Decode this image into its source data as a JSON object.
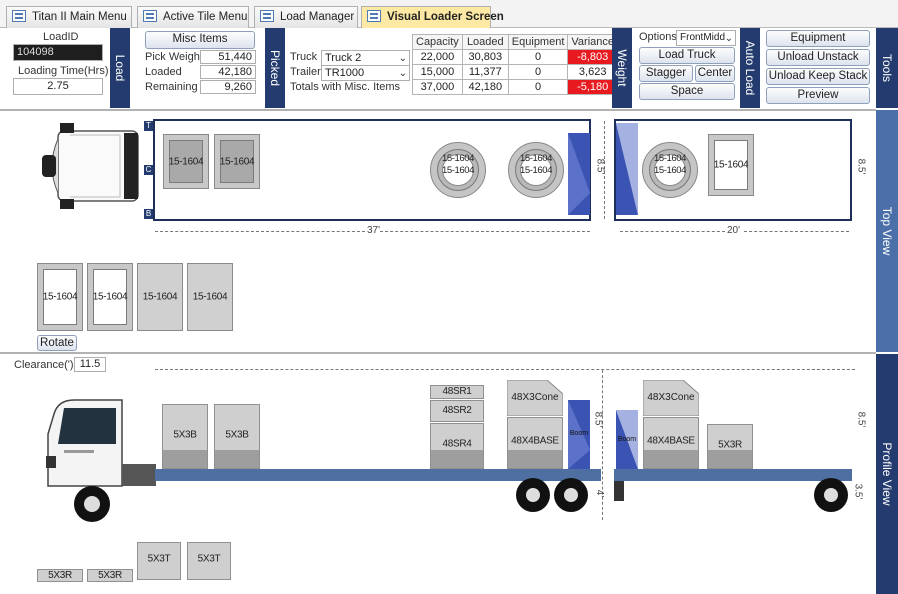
{
  "tabs": [
    {
      "label": "Titan II Main Menu"
    },
    {
      "label": "Active Tile Menu"
    },
    {
      "label": "Load Manager"
    },
    {
      "label": "Visual Loader Screen"
    }
  ],
  "load": {
    "loadid_label": "LoadID",
    "loadid_value": "104098",
    "loading_time_label": "Loading Time(Hrs)",
    "loading_time_value": "2.75",
    "section_label": "Load"
  },
  "misc": {
    "button_label": "Misc Items",
    "rows": [
      {
        "label": "Pick Weight",
        "value": "51,440"
      },
      {
        "label": "Loaded",
        "value": "42,180"
      },
      {
        "label": "Remaining",
        "value": "9,260"
      }
    ]
  },
  "picked": {
    "section_label": "Picked",
    "truck_label": "Truck",
    "truck_value": "Truck 2",
    "trailer_label": "Trailer",
    "trailer_value": "TR1000",
    "totals_label": "Totals with Misc. Items",
    "headers": [
      "Capacity",
      "Loaded",
      "Equipment",
      "Variance"
    ],
    "rows": [
      {
        "capacity": "22,000",
        "loaded": "30,803",
        "equipment": "0",
        "variance": "-8,803",
        "negative": true
      },
      {
        "capacity": "15,000",
        "loaded": "11,377",
        "equipment": "0",
        "variance": "3,623",
        "negative": false
      },
      {
        "capacity": "37,000",
        "loaded": "42,180",
        "equipment": "0",
        "variance": "-5,180",
        "negative": true
      }
    ]
  },
  "weight": {
    "section_label": "Weight",
    "options_label": "Options",
    "options_value": "FrontMidd",
    "load_truck": "Load Truck",
    "stagger": "Stagger",
    "center": "Center",
    "space": "Space"
  },
  "autoload": {
    "section_label": "Auto Load",
    "equipment": "Equipment",
    "unload_unstack": "Unload Unstack",
    "unload_keep_stack": "Unload Keep Stack",
    "preview": "Preview"
  },
  "tools_label": "Tools",
  "top_view": {
    "section_label": "Top View",
    "cab_markers": [
      "T",
      "C",
      "B"
    ],
    "truck_boxes": [
      "15-1604",
      "15-1604"
    ],
    "truck_coils": [
      {
        "a": "15-1604",
        "b": "15-1604"
      },
      {
        "a": "15-1604",
        "b": "15-1604"
      }
    ],
    "trailer_coil": {
      "a": "15-1604",
      "b": "15-1604"
    },
    "trailer_box": "15-1604",
    "truck_width": "8.5'",
    "truck_length": "37'",
    "trailer_width": "8.5'",
    "trailer_length": "20'",
    "staging": [
      "15-1604",
      "15-1604",
      "15-1604",
      "15-1604"
    ],
    "rotate_button": "Rotate"
  },
  "profile_view": {
    "section_label": "Profile View",
    "clearance_label": "Clearance(')",
    "clearance_value": "11.5",
    "truck_items": [
      "5X3B",
      "5X3B"
    ],
    "stack": [
      "48SR1",
      "48SR2",
      "48SR4"
    ],
    "cone": "48X3Cone",
    "base": "48X4BASE",
    "boom": "Boom",
    "truck_height": "8.5'",
    "truck_deck": "4'",
    "trailer_boom": "Boom",
    "trailer_cone": "48X3Cone",
    "trailer_base": "48X4BASE",
    "trailer_item": "5X3R",
    "trailer_height": "8.5'",
    "trailer_deck": "3.5'",
    "staging_top": [
      "5X3T",
      "5X3T"
    ],
    "staging_bottom": [
      "5X3R",
      "5X3R"
    ]
  }
}
